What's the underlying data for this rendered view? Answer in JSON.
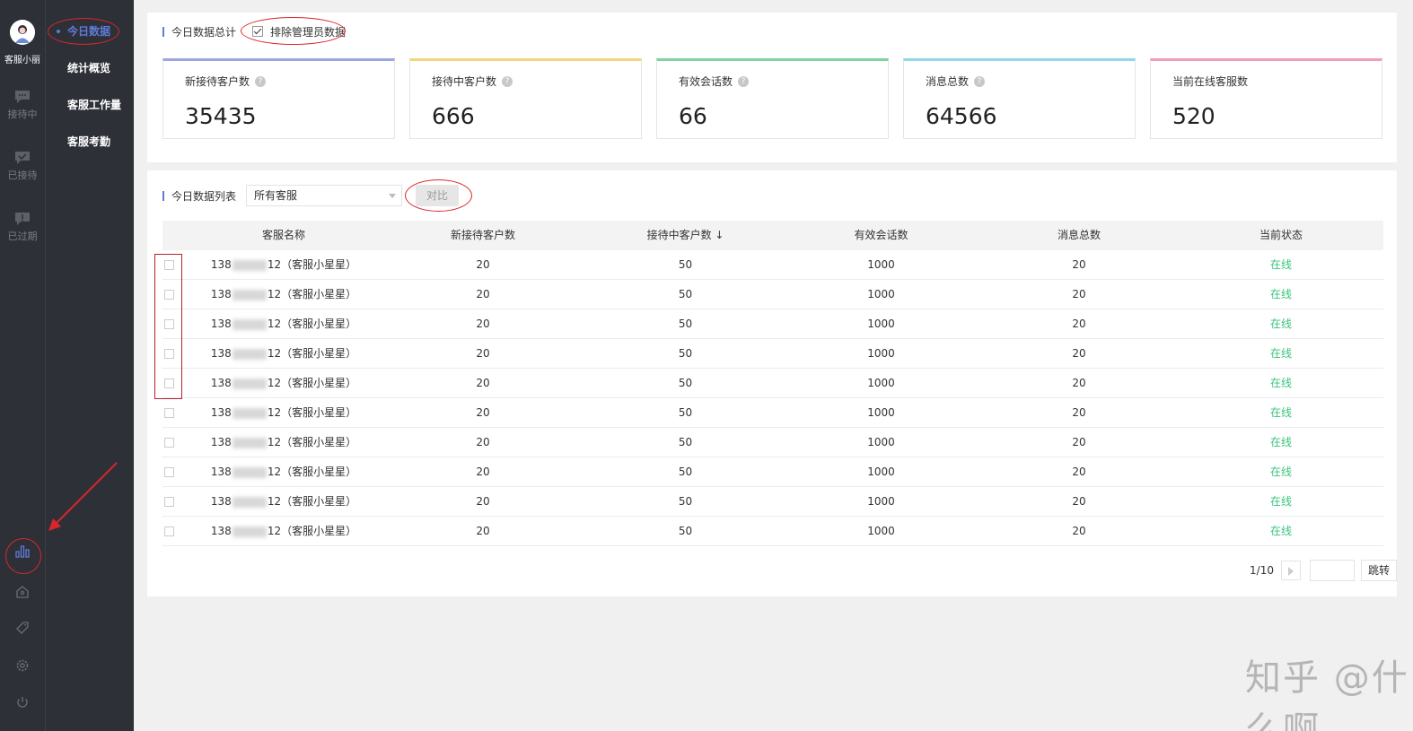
{
  "profile": {
    "name": "客服小丽"
  },
  "rail": [
    {
      "name": "rail-chatting",
      "label": "接待中"
    },
    {
      "name": "rail-received",
      "label": "已接待"
    },
    {
      "name": "rail-expired",
      "label": "已过期"
    }
  ],
  "subnav": {
    "today": "今日数据",
    "overview": "统计概览",
    "workload": "客服工作量",
    "attendance": "客服考勤"
  },
  "summary": {
    "title": "今日数据总计",
    "exclude_label": "排除管理员数据",
    "cards": [
      {
        "label": "新接待客户数",
        "value": "35435",
        "color": "#9ba6e0"
      },
      {
        "label": "接待中客户数",
        "value": "666",
        "color": "#f2d57e"
      },
      {
        "label": "有效会话数",
        "value": "66",
        "color": "#7ed3a2"
      },
      {
        "label": "消息总数",
        "value": "64566",
        "color": "#8fd8e8"
      },
      {
        "label": "当前在线客服数",
        "value": "520",
        "color": "#f29bbd"
      }
    ]
  },
  "list": {
    "title": "今日数据列表",
    "select_value": "所有客服",
    "compare_label": "对比",
    "columns": [
      "客服名称",
      "新接待客户数",
      "接待中客户数 ↓",
      "有效会话数",
      "消息总数",
      "当前状态"
    ],
    "rows": [
      {
        "name_prefix": "138",
        "name_suffix": "12（客服小星星）",
        "new": "20",
        "chatting": "50",
        "sessions": "1000",
        "messages": "20",
        "status": "在线"
      },
      {
        "name_prefix": "138",
        "name_suffix": "12（客服小星星）",
        "new": "20",
        "chatting": "50",
        "sessions": "1000",
        "messages": "20",
        "status": "在线"
      },
      {
        "name_prefix": "138",
        "name_suffix": "12（客服小星星）",
        "new": "20",
        "chatting": "50",
        "sessions": "1000",
        "messages": "20",
        "status": "在线"
      },
      {
        "name_prefix": "138",
        "name_suffix": "12（客服小星星）",
        "new": "20",
        "chatting": "50",
        "sessions": "1000",
        "messages": "20",
        "status": "在线"
      },
      {
        "name_prefix": "138",
        "name_suffix": "12（客服小星星）",
        "new": "20",
        "chatting": "50",
        "sessions": "1000",
        "messages": "20",
        "status": "在线"
      },
      {
        "name_prefix": "138",
        "name_suffix": "12（客服小星星）",
        "new": "20",
        "chatting": "50",
        "sessions": "1000",
        "messages": "20",
        "status": "在线"
      },
      {
        "name_prefix": "138",
        "name_suffix": "12（客服小星星）",
        "new": "20",
        "chatting": "50",
        "sessions": "1000",
        "messages": "20",
        "status": "在线"
      },
      {
        "name_prefix": "138",
        "name_suffix": "12（客服小星星）",
        "new": "20",
        "chatting": "50",
        "sessions": "1000",
        "messages": "20",
        "status": "在线"
      },
      {
        "name_prefix": "138",
        "name_suffix": "12（客服小星星）",
        "new": "20",
        "chatting": "50",
        "sessions": "1000",
        "messages": "20",
        "status": "在线"
      },
      {
        "name_prefix": "138",
        "name_suffix": "12（客服小星星）",
        "new": "20",
        "chatting": "50",
        "sessions": "1000",
        "messages": "20",
        "status": "在线"
      }
    ],
    "pager": {
      "page": "1/10",
      "jump_label": "跳转"
    }
  },
  "colors": {
    "accent": "#5e7bd8",
    "online": "#3ac47d",
    "annotation": "#d9262b"
  },
  "watermark": "知乎 @什么啊"
}
